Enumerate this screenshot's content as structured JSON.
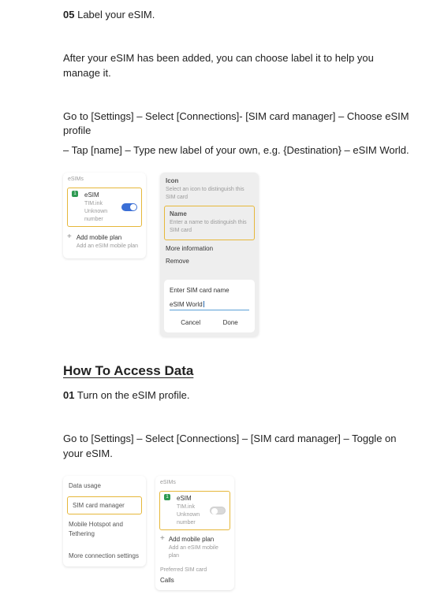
{
  "step05": {
    "num": "05",
    "text": "Label your eSIM."
  },
  "para_after": "After your eSIM has been added, you can choose label it to help you manage it.",
  "para_goto1": "Go to [Settings] – Select [Connections]- [SIM card manager] – Choose eSIM profile",
  "para_tap": "– Tap [name] – Type new label of your own, e.g. {Destination} – eSIM World.",
  "img1_left": {
    "section": "eSIMs",
    "esim_title": "eSIM",
    "esim_sub1": "TIM.ink",
    "esim_sub2": "Unknown number",
    "add_title": "Add mobile plan",
    "add_sub": "Add an eSIM mobile plan"
  },
  "img1_right": {
    "icon_label": "Icon",
    "icon_sub": "Select an icon to distinguish this SIM card",
    "name_label": "Name",
    "name_sub": "Enter a name to distinguish this SIM card",
    "more_info": "More information",
    "remove": "Remove",
    "enter_label": "Enter SIM card name",
    "input_value": "eSIM World",
    "cancel": "Cancel",
    "done": "Done"
  },
  "h_access": "How To Access Data",
  "step01": {
    "num": "01",
    "text": "Turn on the eSIM profile."
  },
  "para_goto2": "Go to [Settings] – Select [Connections] – [SIM card manager] – Toggle on your eSIM.",
  "img2_left": {
    "r1": "Data usage",
    "r2": "SIM card manager",
    "r3": "Mobile Hotspot and Tethering",
    "r4": "More connection settings"
  },
  "img2_right": {
    "section": "eSIMs",
    "esim_title": "eSIM",
    "esim_sub1": "TIM.ink",
    "esim_sub2": "Unknown number",
    "add_title": "Add mobile plan",
    "add_sub": "Add an eSIM mobile plan",
    "pref_section": "Preferred SIM card",
    "calls": "Calls"
  }
}
